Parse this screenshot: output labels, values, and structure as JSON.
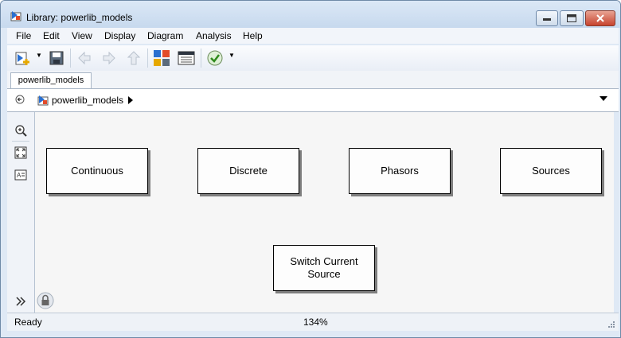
{
  "window": {
    "title": "Library: powerlib_models"
  },
  "menu": [
    "File",
    "Edit",
    "View",
    "Display",
    "Diagram",
    "Analysis",
    "Help"
  ],
  "tab": {
    "label": "powerlib_models"
  },
  "address": {
    "path": "powerlib_models"
  },
  "blocks": [
    {
      "label": "Continuous"
    },
    {
      "label": "Discrete"
    },
    {
      "label": "Phasors"
    },
    {
      "label": "Sources"
    },
    {
      "label": "Switch Current\nSource"
    }
  ],
  "status": {
    "text": "Ready",
    "zoom": "134%"
  },
  "colors": {
    "close_button": "#c7432e",
    "accent": "#2a6fd0"
  }
}
